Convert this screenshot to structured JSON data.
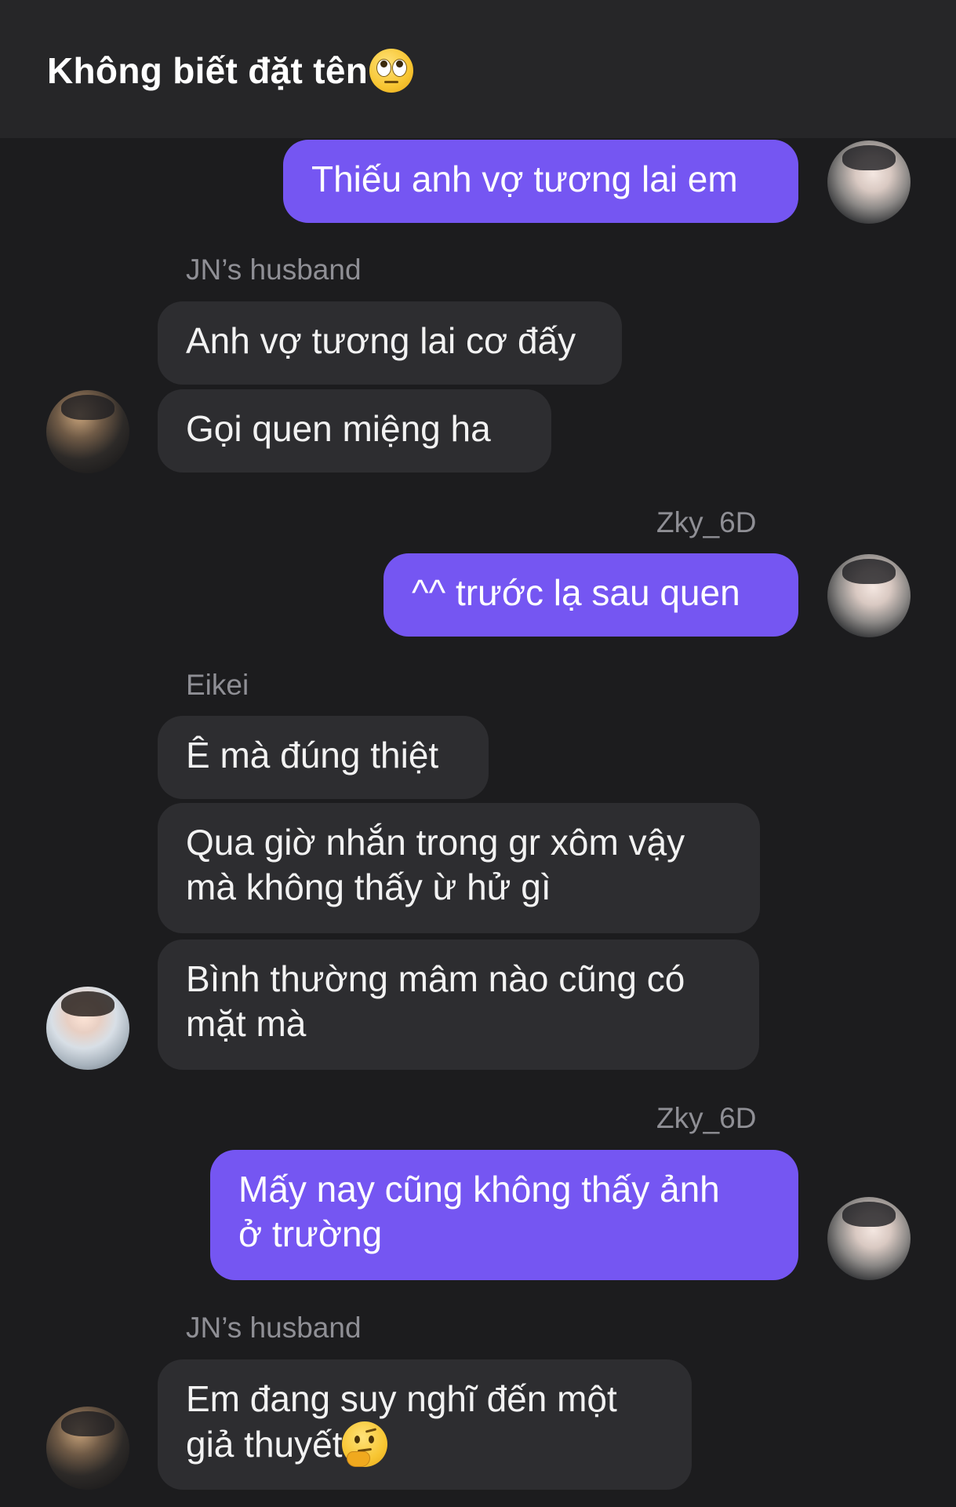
{
  "header": {
    "title": "Không biết đặt tên",
    "title_emoji": "face-with-rolling-eyes"
  },
  "messages": [
    {
      "id": "m1",
      "direction": "outgoing",
      "sender": "",
      "lines": [
        "Thiếu anh vợ tương lai em"
      ],
      "avatar": "zky-avatar"
    },
    {
      "id": "m2",
      "direction": "incoming",
      "sender": "JN’s husband",
      "lines": [
        "Anh vợ tương lai cơ đấy"
      ]
    },
    {
      "id": "m3",
      "direction": "incoming",
      "sender": "",
      "lines": [
        "Gọi quen miệng ha"
      ],
      "avatar": "jn-avatar"
    },
    {
      "id": "m4",
      "direction": "outgoing",
      "sender": "Zky_6D",
      "lines": [
        "^^ trước lạ sau quen"
      ],
      "avatar": "zky-avatar"
    },
    {
      "id": "m5",
      "direction": "incoming",
      "sender": "Eikei",
      "lines": [
        "Ê mà đúng thiệt"
      ]
    },
    {
      "id": "m6",
      "direction": "incoming",
      "sender": "",
      "lines": [
        "Qua giờ nhắn trong gr xôm vậy",
        "mà không thấy ừ hử gì"
      ]
    },
    {
      "id": "m7",
      "direction": "incoming",
      "sender": "",
      "lines": [
        "Bình thường mâm nào cũng có",
        "mặt mà"
      ],
      "avatar": "eikei-avatar"
    },
    {
      "id": "m8",
      "direction": "outgoing",
      "sender": "Zky_6D",
      "lines": [
        "Mấy nay cũng không thấy ảnh",
        "ở trường"
      ],
      "avatar": "zky-avatar"
    },
    {
      "id": "m9",
      "direction": "incoming",
      "sender": "JN’s husband",
      "lines": [
        "Em đang suy nghĩ đến một",
        "giả thuyết"
      ],
      "trailing_emoji": "thinking-face",
      "avatar": "jn-avatar"
    }
  ],
  "colors": {
    "background": "#1c1c1e",
    "header": "#262628",
    "outgoing_bubble": "#7556f2",
    "incoming_bubble": "#2d2d30",
    "sender_name": "#8f8f95"
  }
}
